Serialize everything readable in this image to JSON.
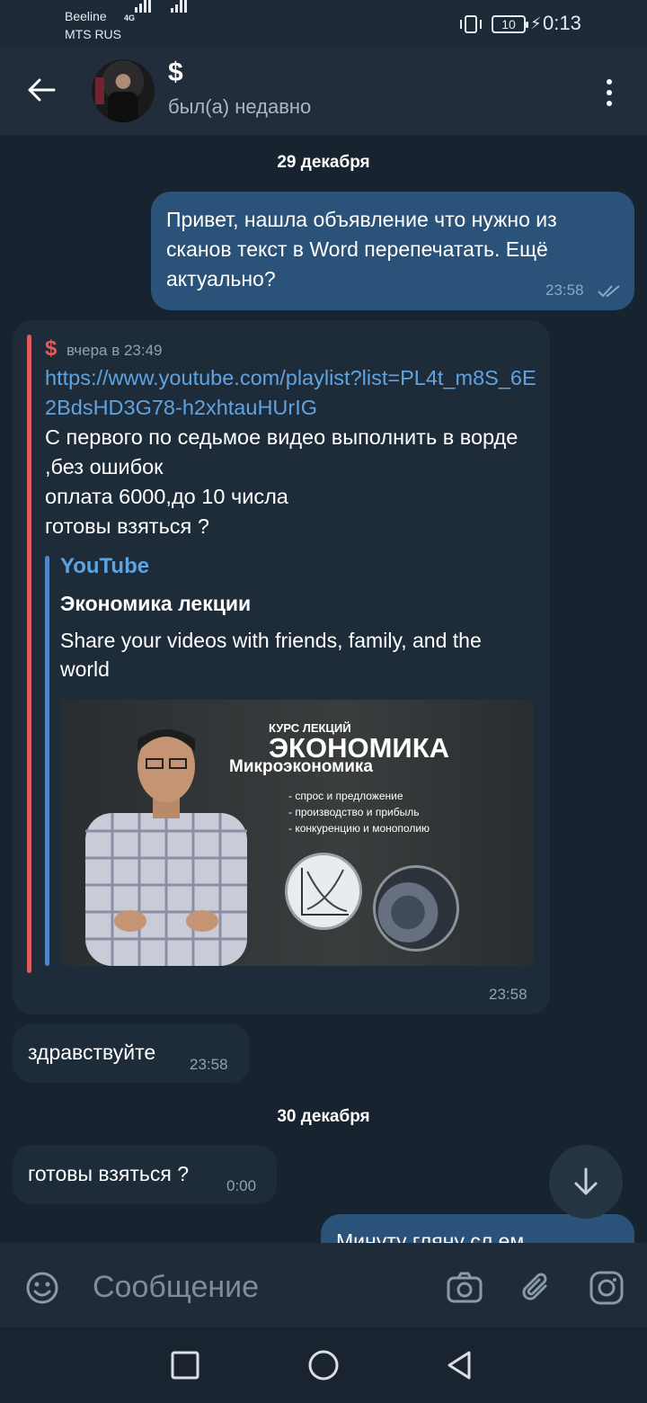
{
  "status_bar": {
    "carrier1": "Beeline",
    "carrier2": "MTS RUS",
    "network": "4G",
    "battery": "10",
    "time": "0:13"
  },
  "header": {
    "name": "$",
    "status": "был(а) недавно"
  },
  "messages": {
    "date1": "29 декабря",
    "out1_text": "Привет, нашла объявление что нужно из сканов текст в Word перепечатать. Ещё актуально?",
    "out1_time": "23:58",
    "fwd_name": "$",
    "fwd_date": "вчера в 23:49",
    "fwd_link": "https://www.youtube.com/playlist?list=PL4t_m8S_6E2BdsHD3G78-h2xhtauHUrIG",
    "fwd_line1": "С первого по седьмое видео выполнить в ворде ,без ошибок",
    "fwd_line2": "оплата 6000,до 10 числа",
    "fwd_line3": "готовы взяться ?",
    "preview_site": "YouTube",
    "preview_title": "Экономика лекции",
    "preview_desc": "Share your videos with friends, family, and the world",
    "thumb_sub1": "КУРС ЛЕКЦИЙ",
    "thumb_main": "ЭКОНОМИКА",
    "thumb_sub2": "Микроэкономика",
    "thumb_item1": "- спрос и предложение",
    "thumb_item2": "- производство и прибыль",
    "thumb_item3": "- конкуренцию и монополию",
    "fwd_time": "23:58",
    "in1_text": "здравствуйте",
    "in1_time": "23:58",
    "date2": "30 декабря",
    "in2_text": "готовы взяться ?",
    "in2_time": "0:00",
    "out2_partial": "Минуту гляну сл.ем"
  },
  "composer": {
    "placeholder": "Сообщение"
  },
  "icons": {
    "back": "arrow-left-icon",
    "menu": "more-vertical-icon",
    "emoji": "smile-icon",
    "camera": "camera-icon",
    "attach": "paperclip-icon",
    "instagram": "instagram-icon",
    "scroll": "arrow-down-icon",
    "read": "double-check-icon"
  },
  "colors": {
    "background": "#182330",
    "outgoing_bubble": "#2b5278",
    "incoming_bubble": "#1e2c3a",
    "link": "#60a3e0",
    "forward_accent": "#e05b5b"
  }
}
